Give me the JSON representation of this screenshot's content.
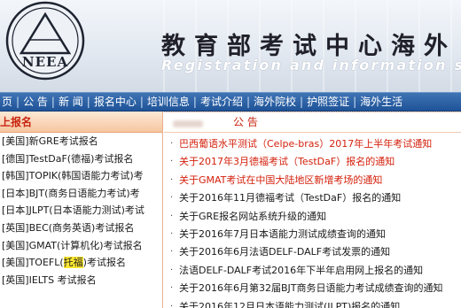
{
  "header": {
    "logo_text": "NEEA",
    "title_cn": "教育部考试中心海外",
    "title_en": "Registration and information service"
  },
  "nav": {
    "items": [
      "页",
      "公 告",
      "新 闻",
      "报名中心",
      "培训信息",
      "考试介绍",
      "海外院校",
      "护照签证",
      "海外生活"
    ],
    "separator": "|"
  },
  "left": {
    "heading": "上报名",
    "items": [
      "[美国]新GRE考试报名",
      "[德国]TestDaF(德福)考试报名",
      "[韩国]TOPIK(韩国语能力考试)考",
      "[日本]BJT(商务日语能力考试)考",
      "[日本]JLPT(日本语能力测试)考试",
      "[英国]BEC(商务英语)考试报名",
      "[美国]GMAT(计算机化)考试报名",
      "[美国]TOEFL(",
      "[英国]IELTS 考试报名"
    ],
    "toefl_highlight": "托福",
    "toefl_suffix": ")考试报名"
  },
  "right": {
    "heading": "公 告",
    "items": [
      "巴西葡语水平测试（Celpe-bras）2017年上半年考试通知",
      "关于2017年3月德福考试（TestDaF）报名的通知",
      "关于GMAT考试在中国大陆地区新增考场的通知",
      "关于2016年11月德福考试（TestDaF）报名的通知",
      "关于GRE报名网站系统升级的通知",
      "关于2016年7月日本语能力测试成绩查询的通知",
      "关于2016年6月法语DELF-DALF考试发票的通知",
      "法语DELF-DALF考试2016年下半年启用网上报名的通知",
      "关于2016年6月第32届BJT商务日语能力考试成绩查询的通知",
      "关于2016年12月日本语能力测试(JLPT)报名的通知"
    ],
    "bullet": "·"
  },
  "colors": {
    "nav_bg": "#2a5fa5",
    "accent_red": "#d4200c",
    "highlight_yellow": "#ffe933",
    "left_head_bg": "#f6c6a0"
  }
}
